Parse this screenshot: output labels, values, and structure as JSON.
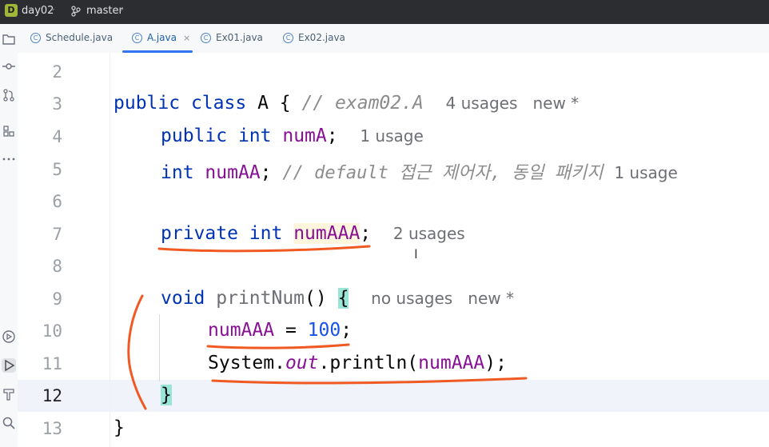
{
  "titlebar": {
    "project_badge": "D",
    "project_name": "day02",
    "branch": "master",
    "caret": "⌄"
  },
  "tabs": [
    {
      "label": "Schedule.java",
      "icon": "class-icon",
      "active": false
    },
    {
      "label": "A.java",
      "icon": "class-icon",
      "active": true,
      "close": "×"
    },
    {
      "label": "Ex01.java",
      "icon": "runnable-class-icon",
      "active": false
    },
    {
      "label": "Ex02.java",
      "icon": "runnable-class-icon",
      "active": false
    }
  ],
  "tab_icon_glyph": "C",
  "toolstrip": [
    "project-icon",
    "commit-icon",
    "pull-requests-icon",
    "structure-icon",
    "more-icon",
    "services-icon",
    "run-icon",
    "build-icon",
    "search-icon"
  ],
  "editor": {
    "current_line": 12,
    "line_numbers": [
      "2",
      "3",
      "4",
      "5",
      "6",
      "7",
      "8",
      "9",
      "10",
      "11",
      "12",
      "13"
    ],
    "l3": {
      "kw1": "public",
      "kw2": "class",
      "name": "A",
      "brace": "{",
      "comment": "// exam02.A",
      "hint": "4 usages   new *"
    },
    "l4": {
      "kw1": "public",
      "kw2": "int",
      "field": "numA",
      "semi": ";",
      "hint": "1 usage"
    },
    "l5": {
      "kw": "int",
      "field": "numAA",
      "semi": ";",
      "comment": "// default 접근 제어자, 동일 패키지",
      "hint": "1 usage"
    },
    "l7": {
      "kw1": "private",
      "kw2": "int",
      "field": "numAAA",
      "semi": ";",
      "hint": "2 usages"
    },
    "l9": {
      "kw": "void",
      "method": "printNum",
      "parens": "()",
      "brace": "{",
      "hint": "no usages   new *"
    },
    "l10": {
      "field": "numAAA",
      "op": " = ",
      "num": "100",
      "semi": ";"
    },
    "l11": {
      "cls": "System",
      "dot1": ".",
      "static": "out",
      "dot2": ".",
      "method": "println",
      "open": "(",
      "arg": "numAAA",
      "close": ");"
    },
    "l12": {
      "brace": "}"
    },
    "l13": {
      "brace": "}"
    }
  },
  "caret_glyph": "I",
  "colors": {
    "annotation": "#f05a22",
    "accent": "#3574f0",
    "keyword": "#0033b3",
    "field": "#871094"
  }
}
